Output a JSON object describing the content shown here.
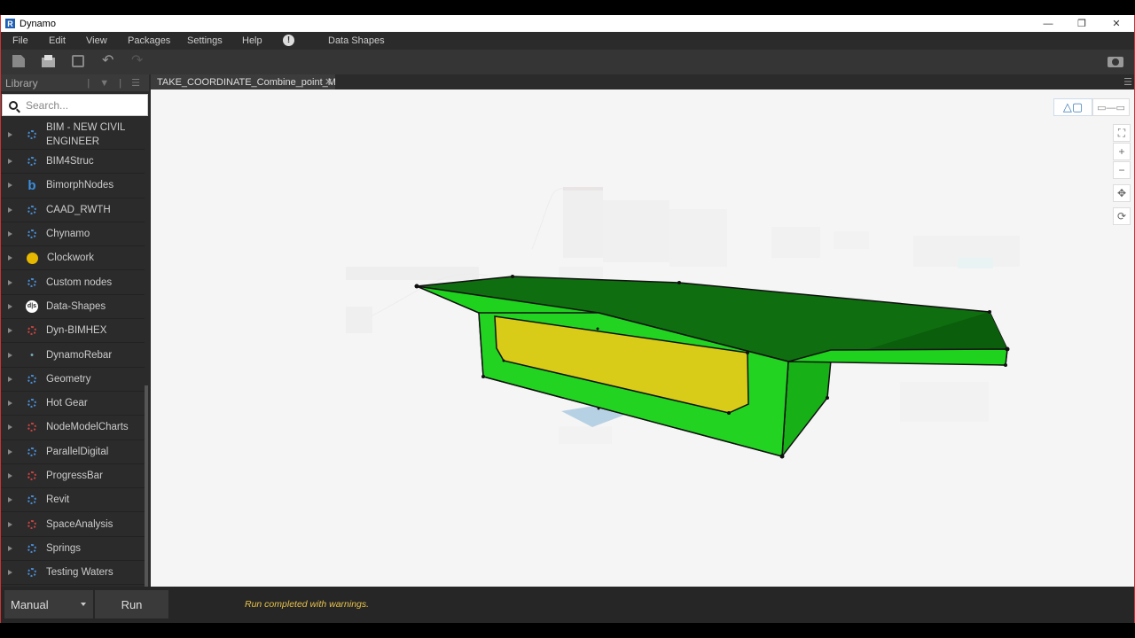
{
  "window": {
    "title": "Dynamo",
    "app_icon": "R"
  },
  "menu": {
    "items": [
      "File",
      "Edit",
      "View",
      "Packages",
      "Settings",
      "Help"
    ],
    "extension": "Data Shapes"
  },
  "library": {
    "title": "Library",
    "search_placeholder": "Search...",
    "items": [
      {
        "label": "BIM - NEW CIVIL ENGINEER",
        "icon": "package-icon"
      },
      {
        "label": "BIM4Struc",
        "icon": "package-icon"
      },
      {
        "label": "BimorphNodes",
        "icon": "bimorph-icon"
      },
      {
        "label": "CAAD_RWTH",
        "icon": "package-icon"
      },
      {
        "label": "Chynamo",
        "icon": "package-icon"
      },
      {
        "label": "Clockwork",
        "icon": "clockwork-icon"
      },
      {
        "label": "Custom nodes",
        "icon": "package-icon"
      },
      {
        "label": "Data-Shapes",
        "icon": "data-shapes-icon"
      },
      {
        "label": "Dyn-BIMHEX",
        "icon": "package-icon"
      },
      {
        "label": "DynamoRebar",
        "icon": "rebar-icon"
      },
      {
        "label": "Geometry",
        "icon": "package-icon"
      },
      {
        "label": "Hot Gear",
        "icon": "package-icon"
      },
      {
        "label": "NodeModelCharts",
        "icon": "package-icon"
      },
      {
        "label": "ParallelDigital",
        "icon": "package-icon"
      },
      {
        "label": "ProgressBar",
        "icon": "package-icon"
      },
      {
        "label": "Revit",
        "icon": "package-icon"
      },
      {
        "label": "SpaceAnalysis",
        "icon": "package-icon"
      },
      {
        "label": "Springs",
        "icon": "package-icon"
      },
      {
        "label": "Testing Waters",
        "icon": "package-icon"
      }
    ]
  },
  "tab": {
    "label": "TAKE_COORDINATE_Combine_point_MC"
  },
  "footer": {
    "run_mode": "Manual",
    "run_label": "Run",
    "status": "Run completed with warnings."
  },
  "colors": {
    "top_face": "#0f6e0f",
    "side_face": "#1ed21e",
    "void_face": "#d8cc18",
    "status_text": "#e8c34a"
  }
}
